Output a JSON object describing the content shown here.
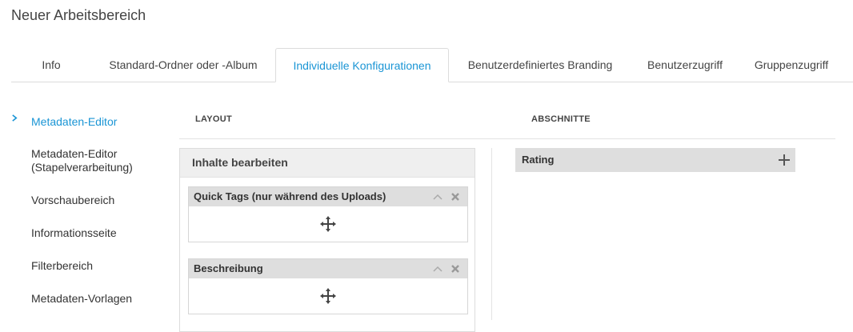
{
  "page": {
    "title": "Neuer Arbeitsbereich"
  },
  "tabs": [
    {
      "label": "Info",
      "active": false
    },
    {
      "label": "Standard-Ordner oder -Album",
      "active": false
    },
    {
      "label": "Individuelle Konfigurationen",
      "active": true
    },
    {
      "label": "Benutzerdefiniertes Branding",
      "active": false
    },
    {
      "label": "Benutzerzugriff",
      "active": false
    },
    {
      "label": "Gruppenzugriff",
      "active": false
    }
  ],
  "sidebar": {
    "items": [
      {
        "label": "Metadaten-Editor",
        "active": true
      },
      {
        "label": "Metadaten-Editor (Stapelverarbeitung)",
        "active": false
      },
      {
        "label": "Vorschaubereich",
        "active": false
      },
      {
        "label": "Informationsseite",
        "active": false
      },
      {
        "label": "Filterbereich",
        "active": false
      },
      {
        "label": "Metadaten-Vorlagen",
        "active": false
      }
    ]
  },
  "layout": {
    "heading": "LAYOUT",
    "panel_title": "Inhalte bearbeiten",
    "widgets": [
      {
        "title": "Quick Tags (nur während des Uploads)"
      },
      {
        "title": "Beschreibung"
      }
    ]
  },
  "sections": {
    "heading": "ABSCHNITTE",
    "items": [
      {
        "label": "Rating"
      }
    ]
  },
  "colors": {
    "accent": "#1a95d5",
    "header_gray": "#dedede",
    "panel_gray": "#efefef"
  },
  "icons": [
    "chevron-right-icon",
    "collapse-icon",
    "close-icon",
    "move-icon",
    "plus-icon"
  ]
}
